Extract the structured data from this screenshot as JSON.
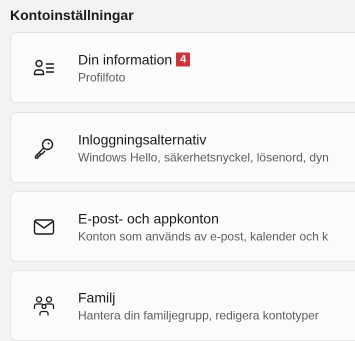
{
  "section": {
    "title": "Kontoinställningar"
  },
  "cards": [
    {
      "title": "Din information",
      "badge": "4",
      "subtitle": "Profilfoto",
      "icon": "person-list-icon"
    },
    {
      "title": "Inloggningsalternativ",
      "subtitle": "Windows Hello, säkerhetsnyckel, lösenord, dyn",
      "icon": "key-icon"
    },
    {
      "title": "E-post- och appkonton",
      "subtitle": "Konton som används av e-post, kalender och k",
      "icon": "mail-icon"
    },
    {
      "title": "Familj",
      "subtitle": "Hantera din familjegrupp, redigera kontotyper",
      "icon": "family-icon"
    }
  ],
  "colors": {
    "background": "#f3f3f3",
    "card": "#fbfbfb",
    "badge": "#d13438",
    "subtitle": "#5d5d5d"
  }
}
